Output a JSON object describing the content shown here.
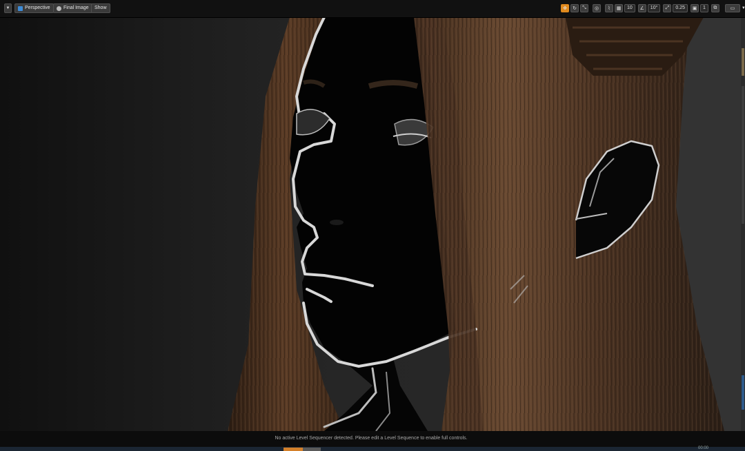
{
  "toolbar": {
    "menu_icon": "chevron-down-icon",
    "view_mode": "Perspective",
    "view_mode_icon": "perspective-icon",
    "lit_mode": "Final Image",
    "lit_mode_icon": "lit-icon",
    "show_label": "Show",
    "grid_snap_value": "10",
    "rotation_snap_value": "10°",
    "scale_snap_value": "0.25",
    "camera_speed_value": "1",
    "accent": "#e08a1e"
  },
  "status": {
    "message": "No active Level Sequencer detected. Please edit a Level Sequence to enable full controls."
  },
  "corner_text": "00:00"
}
